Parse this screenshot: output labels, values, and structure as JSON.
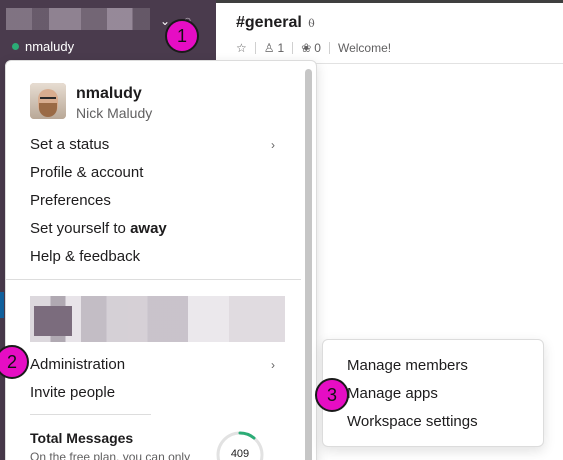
{
  "sidebar": {
    "username": "nmaludy",
    "presence_color": "#2bac76"
  },
  "channel": {
    "title": "#general",
    "members_count": "1",
    "pins_count": "0",
    "topic": "Welcome!"
  },
  "menu": {
    "profile": {
      "display_name": "nmaludy",
      "real_name": "Nick Maludy"
    },
    "items": {
      "set_status": "Set a status",
      "profile_account": "Profile & account",
      "preferences": "Preferences",
      "set_away_prefix": "Set yourself to ",
      "set_away_bold": "away",
      "help_feedback": "Help & feedback",
      "administration": "Administration",
      "invite_people": "Invite people"
    },
    "total_messages": {
      "title": "Total Messages",
      "subtitle": "On the free plan, you can only",
      "count": "409"
    }
  },
  "submenu": {
    "items": [
      "Manage members",
      "Manage apps",
      "Workspace settings"
    ]
  },
  "annotations": [
    "1",
    "2",
    "3"
  ],
  "colors": {
    "sidebar_bg": "#4a3b4d",
    "badge": "#e60dc4",
    "ring_progress": "#2bac76"
  },
  "icons": [
    "chevron-down-icon",
    "bell-icon",
    "star-icon",
    "person-icon",
    "pin-icon",
    "chevron-right-icon"
  ]
}
